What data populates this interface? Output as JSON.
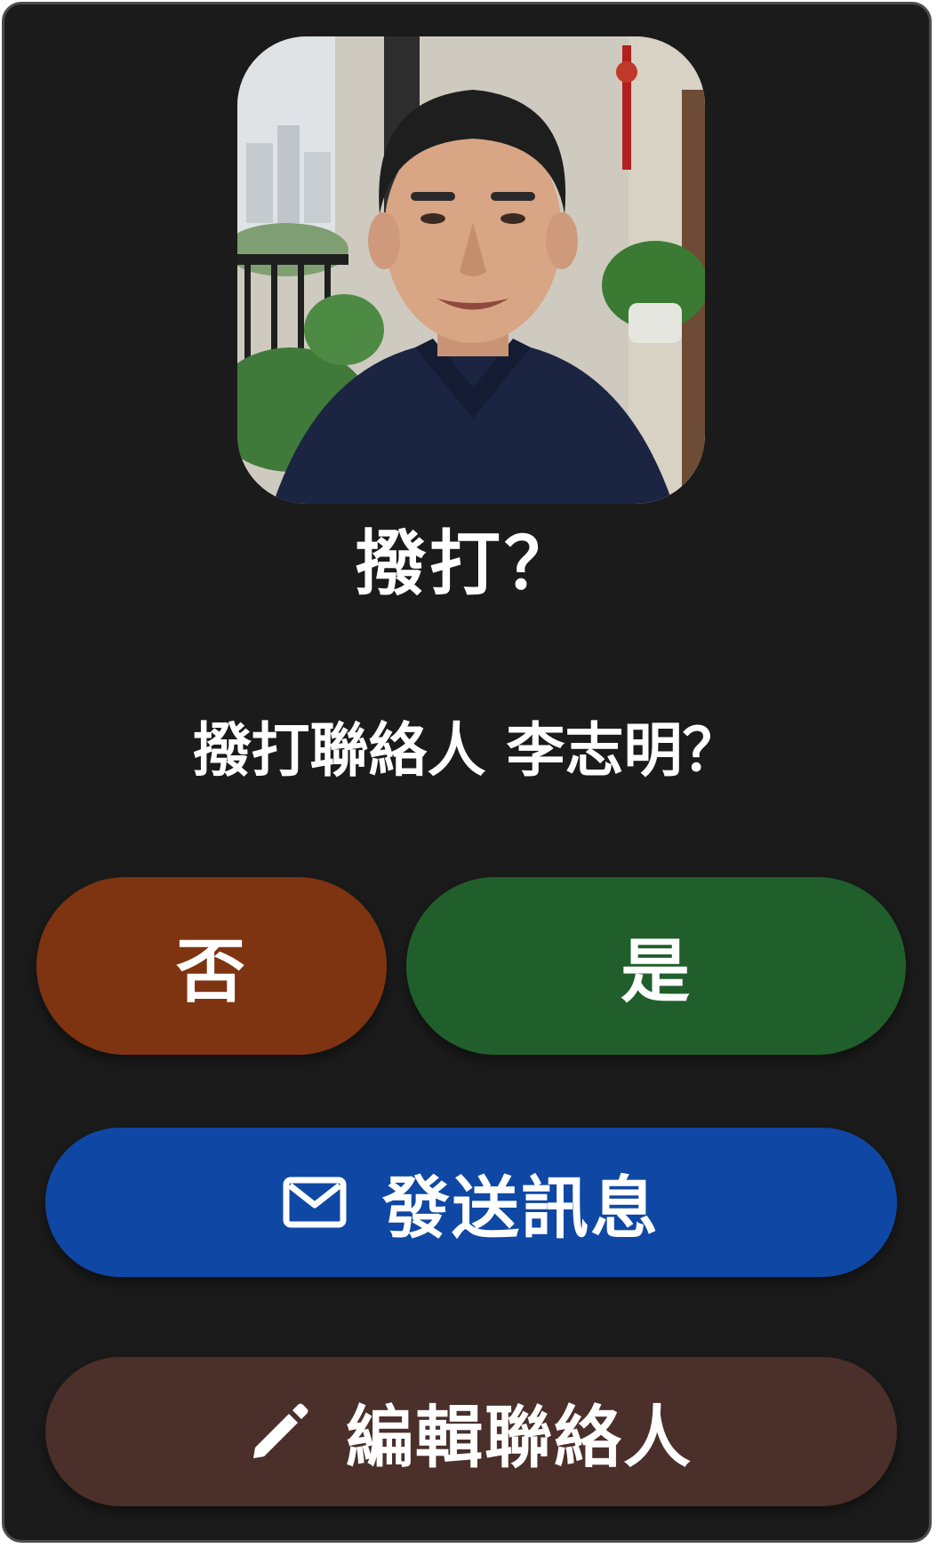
{
  "dialog": {
    "avatar_alt": "contact photo",
    "title": "撥打？",
    "message": "撥打聯絡人 李志明？"
  },
  "buttons": {
    "no_label": "否",
    "yes_label": "是",
    "message_label": "發送訊息",
    "message_icon": "mail-icon",
    "edit_label": "編輯聯絡人",
    "edit_icon": "pencil-icon"
  },
  "colors": {
    "background": "#1b1b1b",
    "no_button": "#7e3411",
    "yes_button": "#205f2b",
    "message_button": "#0f48a4",
    "edit_button": "#4a2f2a"
  }
}
